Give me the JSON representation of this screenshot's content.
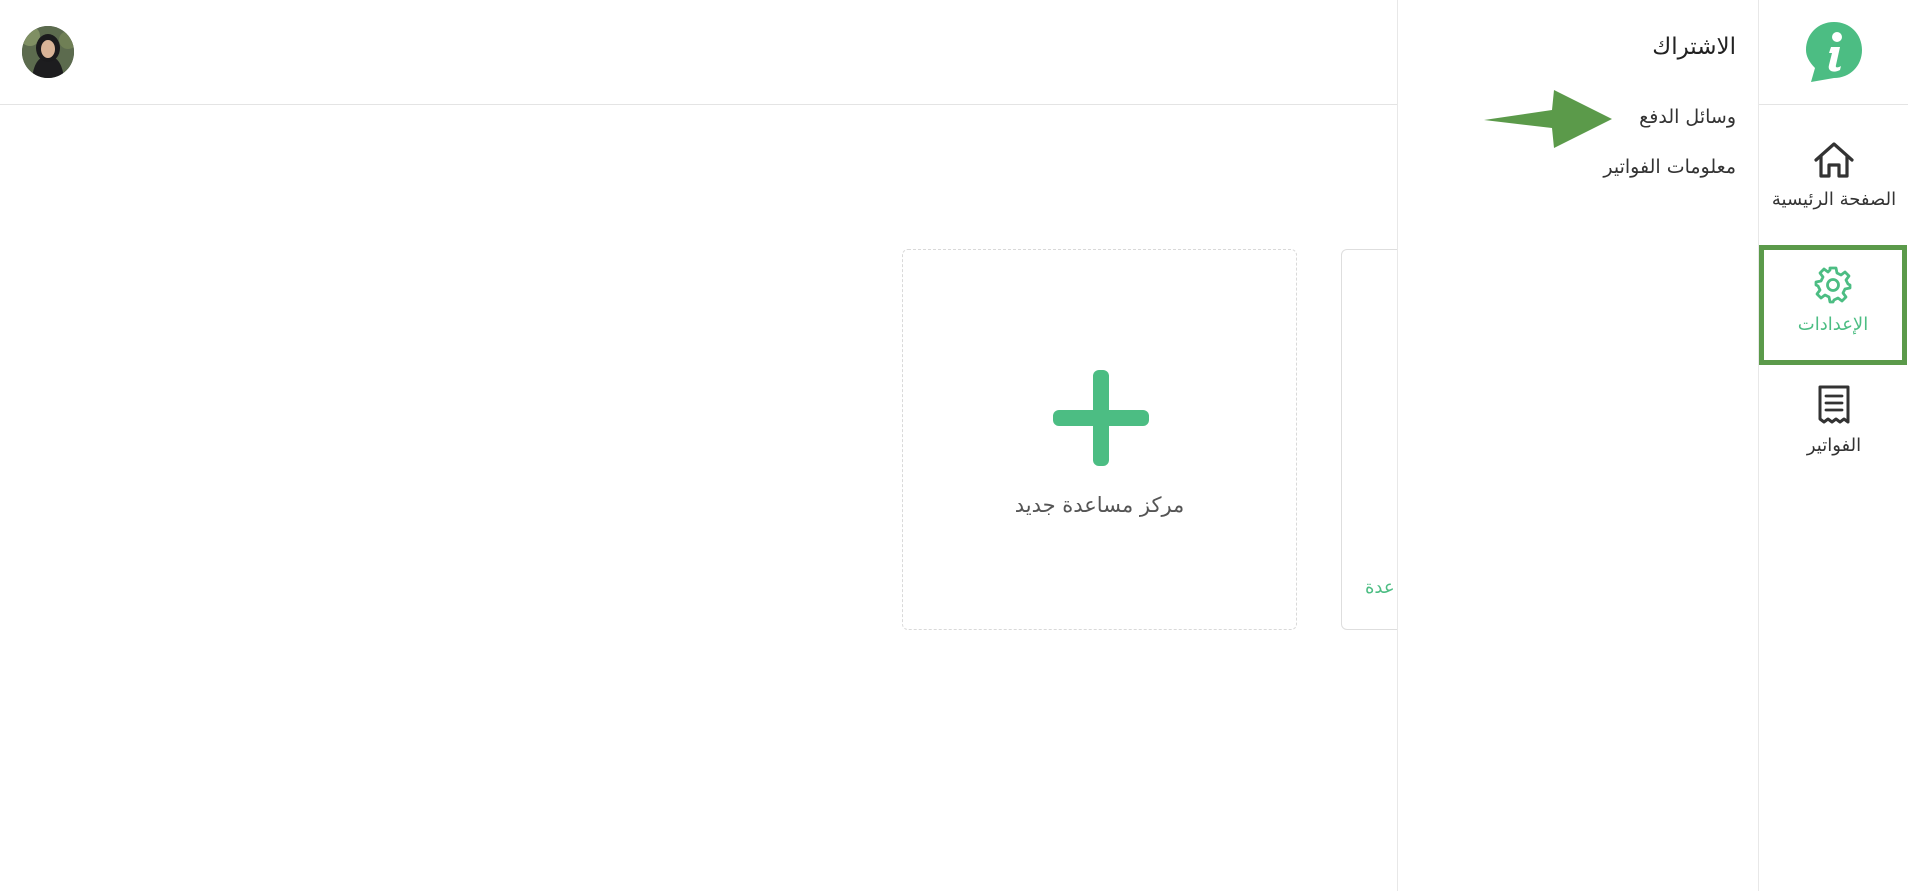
{
  "topbar": {
    "avatar": "user-avatar"
  },
  "main": {
    "new_card_label": "مركز مساعدة جديد",
    "partial_card_link": "عدة"
  },
  "submenu": {
    "title": "الاشتراك",
    "items": [
      {
        "label": "وسائل الدفع"
      },
      {
        "label": "معلومات الفواتير"
      }
    ]
  },
  "sidebar": {
    "items": [
      {
        "label": "الصفحة الرئيسية",
        "icon": "home-icon"
      },
      {
        "label": "الإعدادات",
        "icon": "gear-icon",
        "active": true
      },
      {
        "label": "الفواتير",
        "icon": "receipt-icon"
      }
    ]
  },
  "colors": {
    "accent": "#4cbd83",
    "annotation": "#5b9a4a"
  }
}
